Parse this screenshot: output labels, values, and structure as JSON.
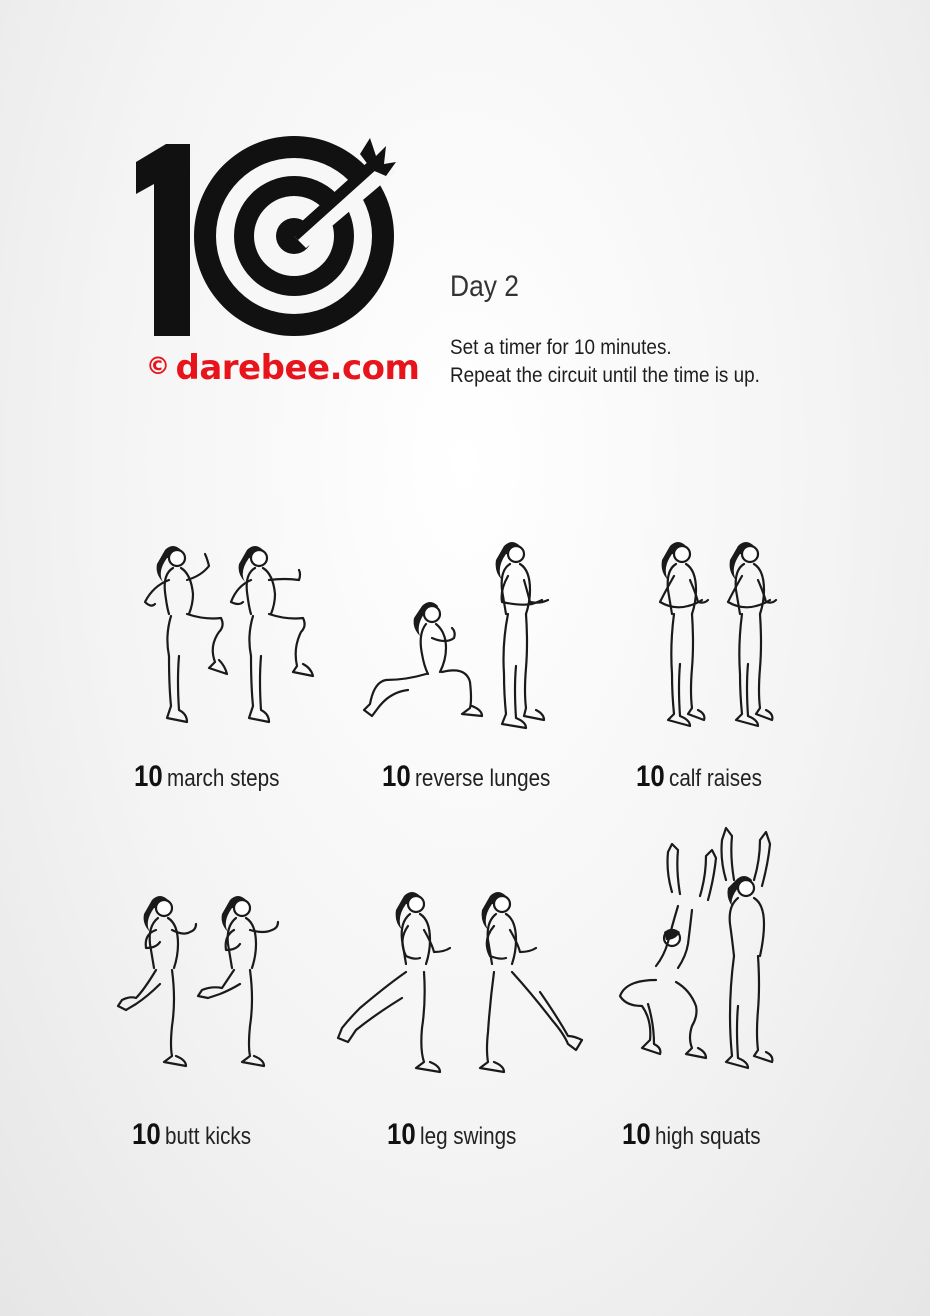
{
  "logo": {
    "icon": "target-arrow-icon",
    "number_text": "10"
  },
  "brand": {
    "copyright": "©",
    "site": "darebee.com",
    "color": "#e8141b"
  },
  "day_title": "Day 2",
  "instructions": {
    "line1": "Set a timer for 10 minutes.",
    "line2": "Repeat the circuit until the time is up."
  },
  "exercises": [
    {
      "reps": "10",
      "name": "march steps"
    },
    {
      "reps": "10",
      "name": "reverse lunges"
    },
    {
      "reps": "10",
      "name": "calf raises"
    },
    {
      "reps": "10",
      "name": "butt kicks"
    },
    {
      "reps": "10",
      "name": "leg swings"
    },
    {
      "reps": "10",
      "name": "high squats"
    }
  ]
}
